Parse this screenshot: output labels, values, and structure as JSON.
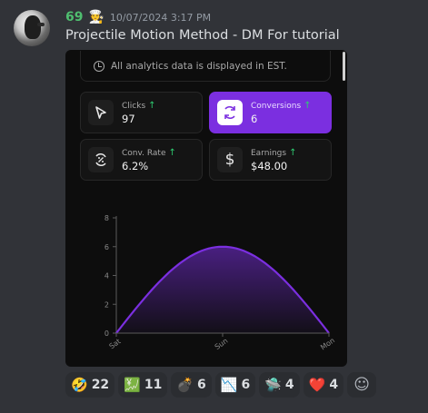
{
  "message": {
    "username": "69",
    "badge_icon": "🧑‍🍳",
    "timestamp": "10/07/2024 3:17 PM",
    "text": "Projectile Motion Method - DM For tutorial"
  },
  "embed": {
    "note": "All analytics data is displayed in EST.",
    "cards": [
      {
        "label": "Clicks",
        "value": "97",
        "icon": "cursor-icon"
      },
      {
        "label": "Conversions",
        "value": "6",
        "icon": "refresh-icon"
      },
      {
        "label": "Conv. Rate",
        "value": "6.2%",
        "icon": "percent-cycle-icon"
      },
      {
        "label": "Earnings",
        "value": "$48.00",
        "icon": "dollar-icon"
      }
    ],
    "accent_color": "#7b2fe0"
  },
  "chart_data": {
    "type": "area",
    "x": [
      "Sat",
      "Sun",
      "Mon"
    ],
    "yticks": [
      "0",
      "2",
      "4",
      "6",
      "8"
    ],
    "ylim": [
      0,
      8
    ],
    "series": [
      {
        "values": [
          0,
          6,
          0
        ]
      }
    ],
    "curve": "smooth",
    "grid": false
  },
  "reactions": [
    {
      "emoji": "🤣",
      "count": "22"
    },
    {
      "emoji": "💹",
      "count": "11"
    },
    {
      "emoji": "💣",
      "count": "6"
    },
    {
      "emoji": "📉",
      "count": "6"
    },
    {
      "emoji": "🛸",
      "count": "4"
    },
    {
      "emoji": "❤️",
      "count": "4"
    }
  ]
}
